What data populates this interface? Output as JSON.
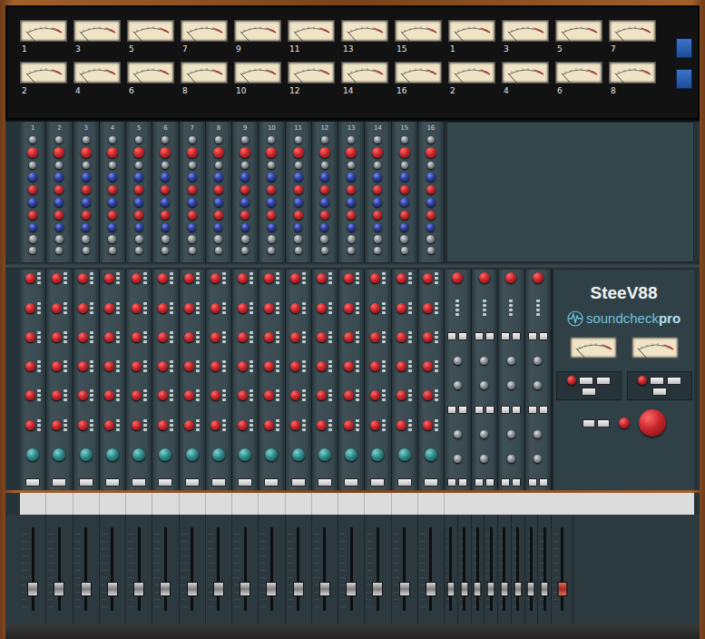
{
  "meter_bridge": {
    "top_row": [
      {
        "label": "1",
        "level": 0.08
      },
      {
        "label": "3",
        "level": 0.08
      },
      {
        "label": "5",
        "level": 0.08
      },
      {
        "label": "7",
        "level": 0.08
      },
      {
        "label": "9",
        "level": 0.08
      },
      {
        "label": "11",
        "level": 0.08
      },
      {
        "label": "13",
        "level": 0.08
      },
      {
        "label": "15",
        "level": 0.08
      },
      {
        "label": "1",
        "level": 0.08
      },
      {
        "label": "3",
        "level": 0.08
      },
      {
        "label": "5",
        "level": 0.08
      },
      {
        "label": "7",
        "level": 0.08
      }
    ],
    "bottom_row": [
      {
        "label": "2",
        "level": 0.08
      },
      {
        "label": "4",
        "level": 0.08
      },
      {
        "label": "6",
        "level": 0.08
      },
      {
        "label": "8",
        "level": 0.08
      },
      {
        "label": "10",
        "level": 0.08
      },
      {
        "label": "12",
        "level": 0.08
      },
      {
        "label": "14",
        "level": 0.08
      },
      {
        "label": "16",
        "level": 0.08
      },
      {
        "label": "2",
        "level": 0.08
      },
      {
        "label": "4",
        "level": 0.08
      },
      {
        "label": "6",
        "level": 0.08
      },
      {
        "label": "8",
        "level": 0.08
      }
    ]
  },
  "upper_strips": [
    {
      "number": "1"
    },
    {
      "number": "2"
    },
    {
      "number": "3"
    },
    {
      "number": "4"
    },
    {
      "number": "5"
    },
    {
      "number": "6"
    },
    {
      "number": "7"
    },
    {
      "number": "8"
    },
    {
      "number": "9"
    },
    {
      "number": "10"
    },
    {
      "number": "11"
    },
    {
      "number": "12"
    },
    {
      "number": "13"
    },
    {
      "number": "14"
    },
    {
      "number": "15"
    },
    {
      "number": "16"
    }
  ],
  "brand": {
    "title": "SteeV88",
    "logo": "soundcheck",
    "logo_accent": "pro"
  },
  "master_meters": [
    {
      "level": 0.08
    },
    {
      "level": 0.08
    }
  ],
  "channel_faders": [
    {
      "level": 0.27
    },
    {
      "level": 0.27
    },
    {
      "level": 0.27
    },
    {
      "level": 0.27
    },
    {
      "level": 0.27
    },
    {
      "level": 0.27
    },
    {
      "level": 0.27
    },
    {
      "level": 0.27
    },
    {
      "level": 0.27
    },
    {
      "level": 0.27
    },
    {
      "level": 0.27
    },
    {
      "level": 0.27
    },
    {
      "level": 0.27
    },
    {
      "level": 0.27
    },
    {
      "level": 0.27
    },
    {
      "level": 0.27
    }
  ],
  "group_faders": [
    {
      "level": 0.27
    },
    {
      "level": 0.27
    },
    {
      "level": 0.27
    },
    {
      "level": 0.27
    },
    {
      "level": 0.27
    },
    {
      "level": 0.27
    },
    {
      "level": 0.27
    },
    {
      "level": 0.27
    }
  ],
  "master_fader": {
    "level": 0.27
  }
}
